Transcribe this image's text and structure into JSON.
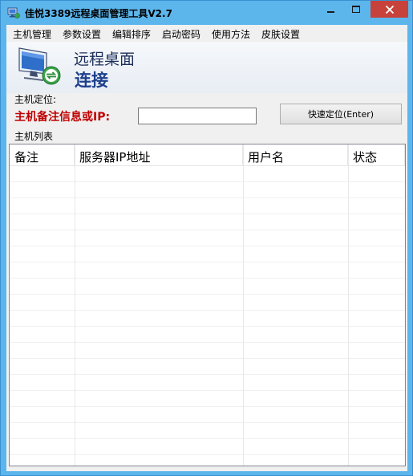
{
  "window": {
    "title": "佳悦3389远程桌面管理工具V2.7",
    "icon": "app-monitor-icon",
    "controls": {
      "minimize": "minimize-icon",
      "maximize": "maximize-icon",
      "close": "close-icon"
    },
    "colors": {
      "titlebar": "#5cb6ec",
      "close": "#c7423a",
      "client": "#f0f0f0"
    }
  },
  "menu": {
    "items": [
      {
        "label": "主机管理"
      },
      {
        "label": "参数设置"
      },
      {
        "label": "编辑排序"
      },
      {
        "label": "启动密码"
      },
      {
        "label": "使用方法"
      },
      {
        "label": "皮肤设置"
      }
    ]
  },
  "banner": {
    "icon": "remote-desktop-icon",
    "line1": "远程桌面",
    "line2": "连接"
  },
  "locate": {
    "section_label": "主机定位:",
    "field_label": "主机备注信息或IP:",
    "input_value": "",
    "button_label": "快速定位(Enter)"
  },
  "host_list": {
    "section_label": "主机列表",
    "columns": [
      "备注",
      "服务器IP地址",
      "用户名",
      "状态"
    ],
    "rows": []
  }
}
